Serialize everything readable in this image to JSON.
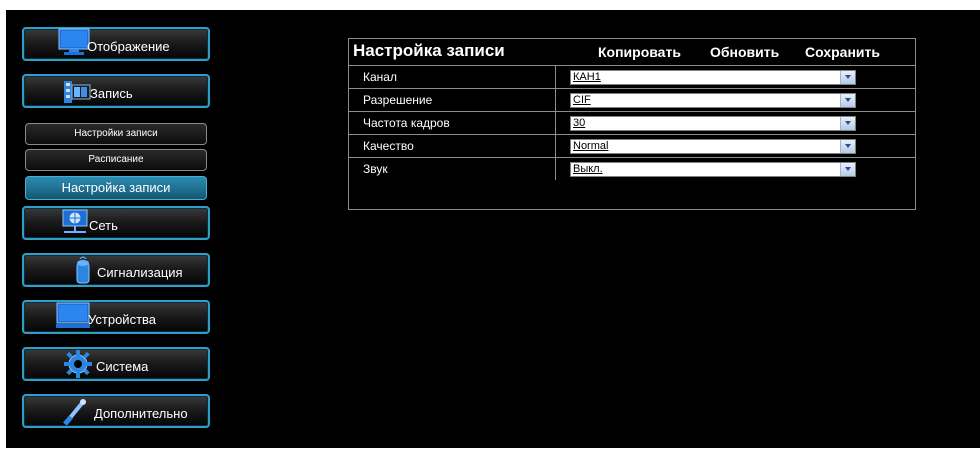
{
  "sidebar": {
    "items": [
      {
        "label": "Отображение",
        "icon": "monitor-icon"
      },
      {
        "label": "Запись",
        "icon": "film-icon"
      },
      {
        "label": "Сеть",
        "icon": "network-icon"
      },
      {
        "label": "Сигнализация",
        "icon": "alarm-icon"
      },
      {
        "label": "Устройства",
        "icon": "device-icon"
      },
      {
        "label": "Система",
        "icon": "gear-icon"
      },
      {
        "label": "Дополнительно",
        "icon": "tool-icon"
      }
    ],
    "subitems": [
      {
        "label": "Настройки записи"
      },
      {
        "label": "Расписание"
      },
      {
        "label": "Настройка записи",
        "active": true
      }
    ]
  },
  "panel": {
    "title": "Настройка записи",
    "copy_label": "Копировать",
    "refresh_label": "Обновить",
    "save_label": "Сохранить",
    "rows": [
      {
        "label": "Канал",
        "value": "КАН1"
      },
      {
        "label": "Разрешение",
        "value": "CIF"
      },
      {
        "label": "Частота кадров",
        "value": "30"
      },
      {
        "label": "Качество",
        "value": "Normal"
      },
      {
        "label": "Звук",
        "value": "Выкл."
      }
    ]
  },
  "colors": {
    "accent": "#2f9fc8",
    "active_sub": "#1f6f90",
    "background": "#000000",
    "border": "#8c8c8c"
  }
}
